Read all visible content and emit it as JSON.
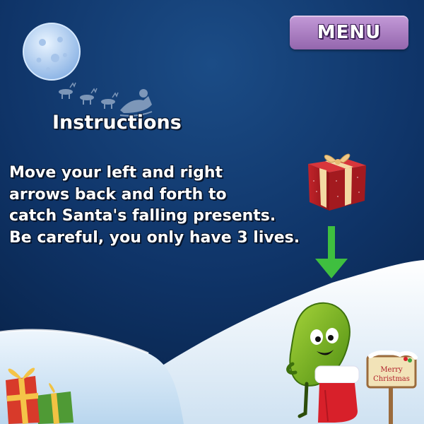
{
  "menu": {
    "label": "MENU"
  },
  "instructions": {
    "title": "Instructions",
    "lines": [
      "Move your left and right",
      "arrows back and forth to",
      "catch Santa's falling presents.",
      "Be careful, you only have 3 lives."
    ]
  },
  "sign": {
    "line1": "Merry",
    "line2": "Christmas"
  },
  "icons": {
    "moon": "moon-icon",
    "sleigh": "santa-sleigh-icon",
    "present": "falling-present-icon",
    "arrow": "down-arrow-icon",
    "character": "green-bean-character",
    "stocking": "christmas-stocking-icon"
  },
  "colors": {
    "sky_top": "#0a2a55",
    "sky_bottom": "#2d6aa8",
    "menu": "#a877c2",
    "arrow": "#3fbf3f",
    "present": "#b01e1e",
    "character": "#7cba1f"
  }
}
